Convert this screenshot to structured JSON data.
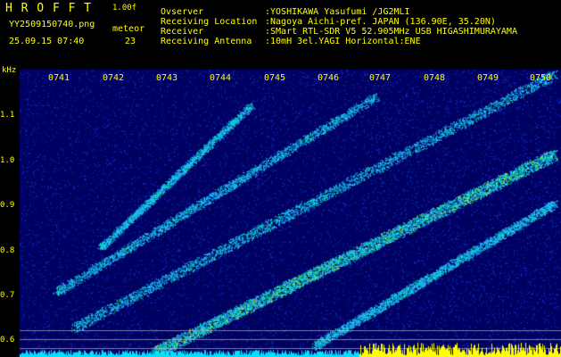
{
  "header": {
    "logo": "H R O F F T",
    "version": "1.00f",
    "filename": "YY2509150740.png",
    "datetime": "25.09.15 07:40",
    "meteor_label": "meteor",
    "meteor_count": "23"
  },
  "info": {
    "labels": [
      "Ovserver",
      "Receiving Location",
      "Receiver",
      "Receiving Antenna"
    ],
    "values": [
      ":YOSHIKAWA Yasufumi /JG2MLI",
      ":Nagoya Aichi-pref. JAPAN (136.90E, 35.20N)",
      ":SMart RTL-SDR V5 52.905MHz USB HIGASHIMURAYAMA",
      ":10mH 3el.YAGI Horizontal:ENE"
    ]
  },
  "spectrogram": {
    "unit": "kHz",
    "y_ticks": [
      "1.1",
      "1.0",
      "0.9",
      "0.8",
      "0.7",
      "0.6"
    ],
    "x_ticks": [
      "0741",
      "0742",
      "0743",
      "0744",
      "0745",
      "0746",
      "0747",
      "0748",
      "0749",
      "0750"
    ],
    "colors": {
      "background": "#000060",
      "noise": "#1030d0",
      "signal_mid": "#20c0ff",
      "signal_high": "#00ff80",
      "signal_peak": "#ffff00",
      "axis": "#ffff00",
      "baseline_band": "#00e0ff"
    }
  }
}
